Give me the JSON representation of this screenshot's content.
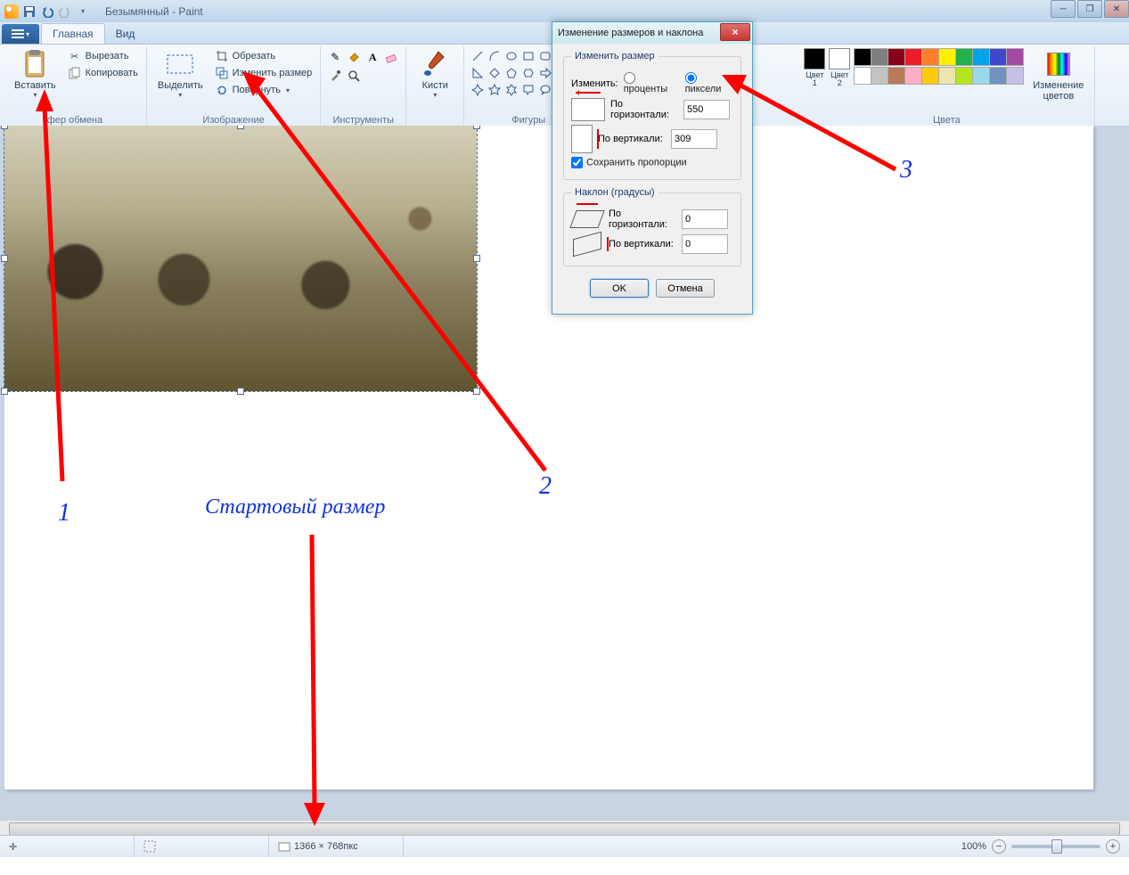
{
  "title": "Безымянный - Paint",
  "tabs": {
    "home": "Главная",
    "view": "Вид"
  },
  "ribbon": {
    "clipboard": {
      "paste": "Вставить",
      "cut": "Вырезать",
      "copy": "Копировать",
      "label": "фер обмена"
    },
    "image": {
      "select": "Выделить",
      "crop": "Обрезать",
      "resize": "Изменить размер",
      "rotate": "Повернуть",
      "label": "Изображение"
    },
    "tools": {
      "label": "Инструменты"
    },
    "brushes": {
      "label": "Кисти"
    },
    "shapes": {
      "label": "Фигуры"
    },
    "colors": {
      "c1": "Цвет\n1",
      "c2": "Цвет\n2",
      "edit": "Изменение\nцветов",
      "label": "Цвета"
    }
  },
  "palette": [
    "#000000",
    "#7f7f7f",
    "#880015",
    "#ed1c24",
    "#ff7f27",
    "#fff200",
    "#22b14c",
    "#00a2e8",
    "#3f48cc",
    "#a349a4",
    "#ffffff",
    "#c3c3c3",
    "#b97a57",
    "#ffaec9",
    "#ffc90e",
    "#efe4b0",
    "#b5e61d",
    "#99d9ea",
    "#7092be",
    "#c8bfe7"
  ],
  "color1": "#000000",
  "color2": "#ffffff",
  "dialog": {
    "title": "Изменение размеров и наклона",
    "resize_legend": "Изменить размер",
    "by_label": "Изменить:",
    "percent": "проценты",
    "pixels": "пиксели",
    "horiz": "По горизонтали:",
    "vert": "По вертикали:",
    "h_val": "550",
    "v_val": "309",
    "keep_ratio": "Сохранить пропорции",
    "skew_legend": "Наклон (градусы)",
    "skew_h": "0",
    "skew_v": "0",
    "ok": "OK",
    "cancel": "Отмена",
    "vert_short": "По вертикали:"
  },
  "status": {
    "size": "1366 × 768пкс",
    "zoom": "100%"
  },
  "annot": {
    "n1": "1",
    "n2": "2",
    "n3": "3",
    "start": "Стартовый размер"
  }
}
